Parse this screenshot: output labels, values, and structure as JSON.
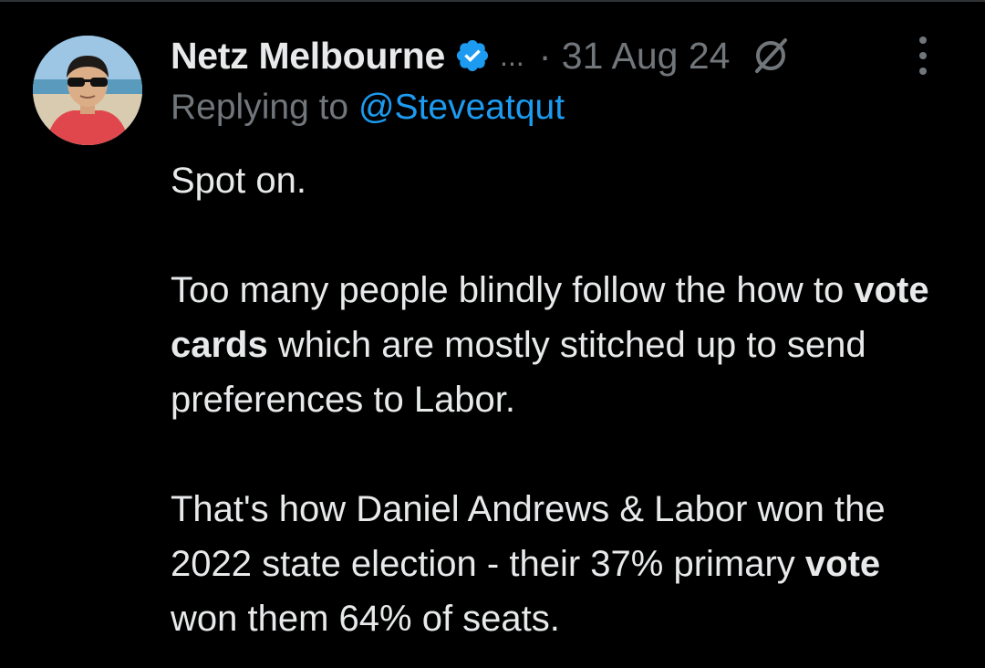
{
  "tweet": {
    "author_name": "Netz Melbourne",
    "truncation": "...",
    "timestamp": "· 31 Aug 24",
    "replying_prefix": "Replying to",
    "replying_handle": "@Steveatqut",
    "paragraphs": [
      [
        "Spot on."
      ],
      [
        "Too many people blindly follow the how to ",
        "vote cards",
        " which are  mostly stitched up to send preferences to Labor."
      ],
      [
        "That's how Daniel Andrews & Labor won the 2022 state election - their 37% primary ",
        "vote",
        " won them 64% of seats."
      ]
    ],
    "icons": {
      "verified": "verified-badge-icon",
      "grok": "grok-icon",
      "more": "more-options-icon"
    },
    "colors": {
      "background": "#000000",
      "text": "#e7e9ea",
      "secondary": "#71767b",
      "accent": "#1d9bf0"
    }
  }
}
